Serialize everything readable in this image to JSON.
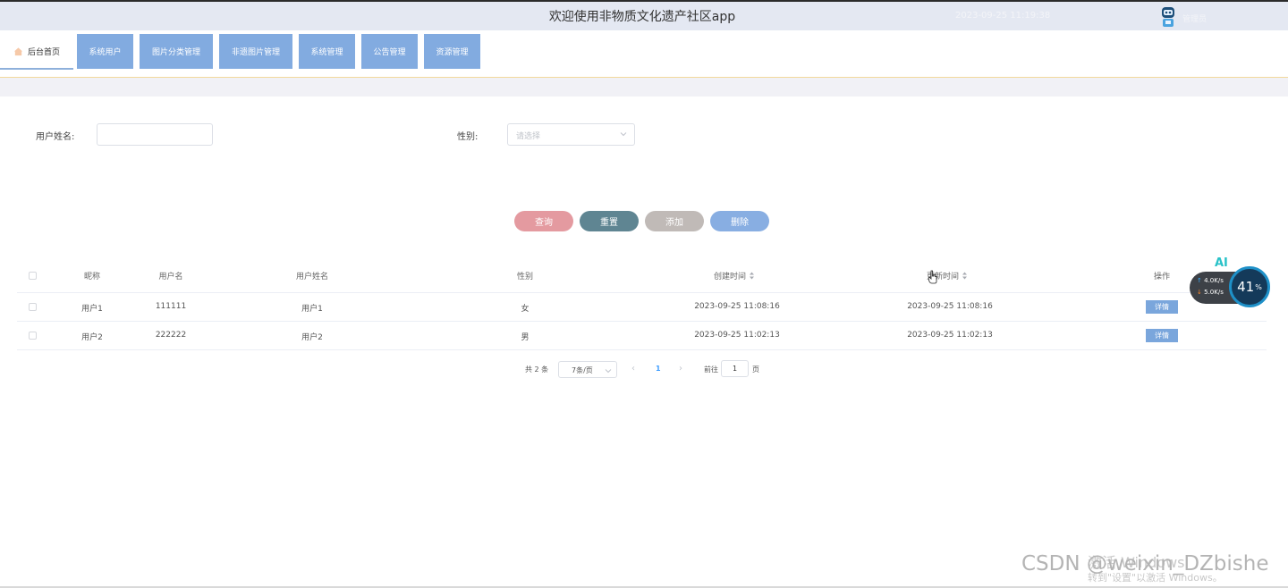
{
  "header": {
    "title": "欢迎使用非物质文化遗产社区app",
    "datetime": "2023-09-25 11:19:38",
    "user_role": "管理员"
  },
  "nav": {
    "home": "后台首页",
    "items": [
      "系统用户",
      "图片分类管理",
      "非遗图片管理",
      "系统管理",
      "公告管理",
      "资源管理"
    ]
  },
  "search": {
    "username_label": "用户姓名:",
    "username_value": "",
    "gender_label": "性别:",
    "gender_placeholder": "请选择"
  },
  "actions": {
    "query": "查询",
    "reset": "重置",
    "add": "添加",
    "delete": "删除"
  },
  "table": {
    "columns": [
      "昵称",
      "用户名",
      "用户姓名",
      "性别",
      "创建时间",
      "更新时间",
      "操作"
    ],
    "rows": [
      {
        "nickname": "用户1",
        "username": "111111",
        "realname": "用户1",
        "gender": "女",
        "created": "2023-09-25 11:08:16",
        "updated": "2023-09-25 11:08:16",
        "action": "详情"
      },
      {
        "nickname": "用户2",
        "username": "222222",
        "realname": "用户2",
        "gender": "男",
        "created": "2023-09-25 11:02:13",
        "updated": "2023-09-25 11:02:13",
        "action": "详情"
      }
    ]
  },
  "pagination": {
    "total": "共 2 条",
    "page_size": "7条/页",
    "current_page": "1",
    "goto_label": "前往",
    "goto_value": "1",
    "page_suffix": "页"
  },
  "overlay": {
    "ai_badge": "AI",
    "upload_speed": "4.0",
    "download_speed": "5.0",
    "speed_unit": "K/s",
    "gauge_value": "41",
    "gauge_unit": "%"
  },
  "watermark": {
    "activate_title": "激活 Windows",
    "activate_hint": "转到\"设置\"以激活 Windows。",
    "csdn": "CSDN @weixin_DZbishe"
  },
  "colors": {
    "query": "#e49aa0",
    "reset": "#5f8592",
    "add": "#c0bab7",
    "delete": "#88aee2",
    "nav": "#82abe0",
    "detail": "#7aa6dc"
  }
}
